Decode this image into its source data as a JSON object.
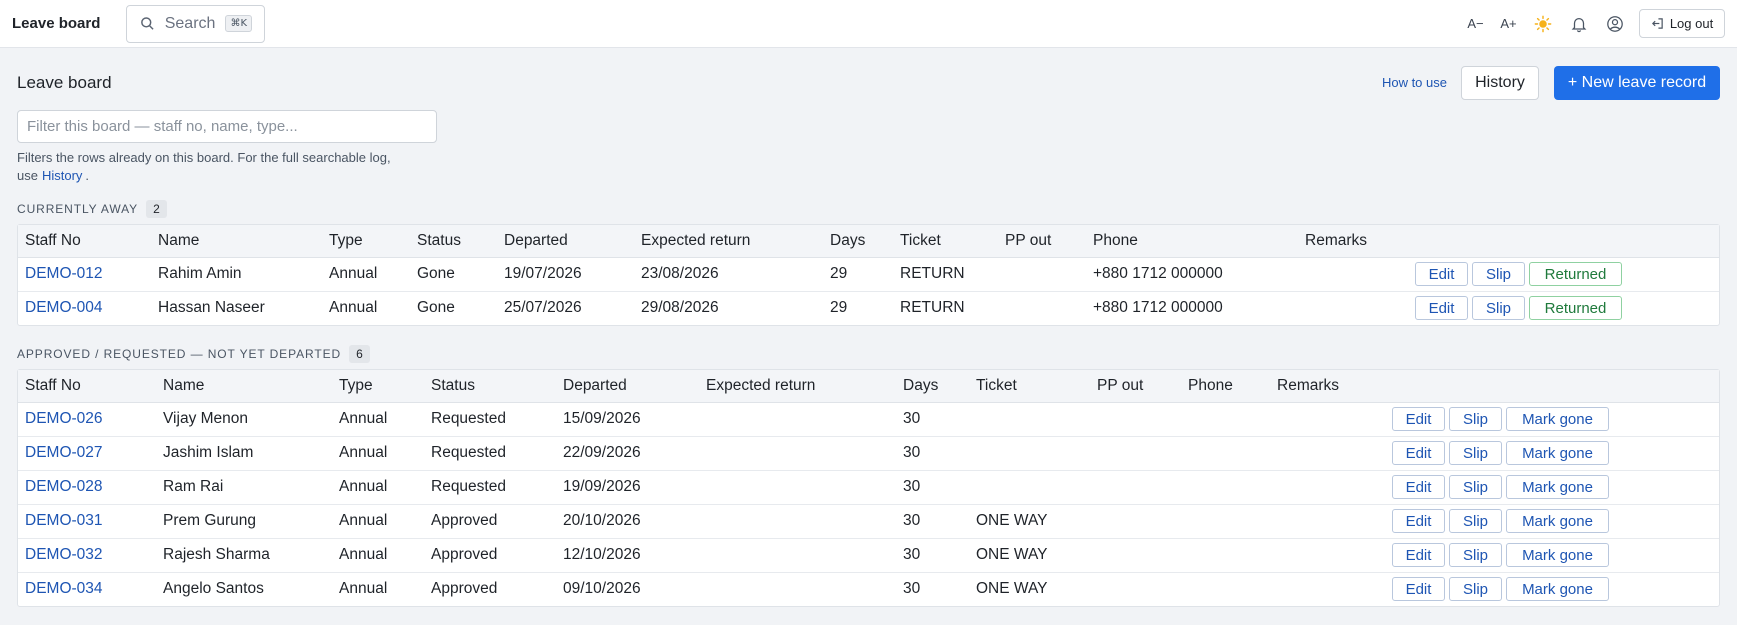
{
  "topbar": {
    "brand": "Leave board",
    "search_label": "Search",
    "search_shortcut": "⌘K",
    "font_decrease": "A−",
    "font_increase": "A+",
    "theme_icon": "sun-icon",
    "bell_icon": "bell-icon",
    "user_icon": "user-circle-icon",
    "logout_label": "Log out"
  },
  "header": {
    "title": "Leave board",
    "how_to_use": "How to use",
    "history_button": "History",
    "new_button": "+ New leave record"
  },
  "filter": {
    "placeholder": "Filter this board — staff no, name, type...",
    "help_prefix": "Filters the rows already on this board. For the full searchable log, use",
    "help_link": "History",
    "help_suffix": "."
  },
  "away": {
    "label": "CURRENTLY AWAY",
    "count": "2",
    "columns": [
      "Staff No",
      "Name",
      "Type",
      "Status",
      "Departed",
      "Expected return",
      "Days",
      "Ticket",
      "PP out",
      "Phone",
      "Remarks"
    ],
    "rows": [
      {
        "staff_no": "DEMO-012",
        "name": "Rahim Amin",
        "type": "Annual",
        "status": "Gone",
        "departed": "19/07/2026",
        "expected_return": "23/08/2026",
        "days": "29",
        "ticket": "RETURN",
        "pp_out": "",
        "phone": "+880 1712 000000",
        "remarks": ""
      },
      {
        "staff_no": "DEMO-004",
        "name": "Hassan Naseer",
        "type": "Annual",
        "status": "Gone",
        "departed": "25/07/2026",
        "expected_return": "29/08/2026",
        "days": "29",
        "ticket": "RETURN",
        "pp_out": "",
        "phone": "+880 1712 000000",
        "remarks": ""
      }
    ],
    "actions": {
      "edit": "Edit",
      "slip": "Slip",
      "returned": "Returned"
    }
  },
  "pending": {
    "label": "APPROVED / REQUESTED — NOT YET DEPARTED",
    "count": "6",
    "columns": [
      "Staff No",
      "Name",
      "Type",
      "Status",
      "Departed",
      "Expected return",
      "Days",
      "Ticket",
      "PP out",
      "Phone",
      "Remarks"
    ],
    "rows": [
      {
        "staff_no": "DEMO-026",
        "name": "Vijay Menon",
        "type": "Annual",
        "status": "Requested",
        "departed": "15/09/2026",
        "expected_return": "",
        "days": "30",
        "ticket": "",
        "pp_out": "",
        "phone": "",
        "remarks": ""
      },
      {
        "staff_no": "DEMO-027",
        "name": "Jashim Islam",
        "type": "Annual",
        "status": "Requested",
        "departed": "22/09/2026",
        "expected_return": "",
        "days": "30",
        "ticket": "",
        "pp_out": "",
        "phone": "",
        "remarks": ""
      },
      {
        "staff_no": "DEMO-028",
        "name": "Ram Rai",
        "type": "Annual",
        "status": "Requested",
        "departed": "19/09/2026",
        "expected_return": "",
        "days": "30",
        "ticket": "",
        "pp_out": "",
        "phone": "",
        "remarks": ""
      },
      {
        "staff_no": "DEMO-031",
        "name": "Prem Gurung",
        "type": "Annual",
        "status": "Approved",
        "departed": "20/10/2026",
        "expected_return": "",
        "days": "30",
        "ticket": "ONE WAY",
        "pp_out": "",
        "phone": "",
        "remarks": ""
      },
      {
        "staff_no": "DEMO-032",
        "name": "Rajesh Sharma",
        "type": "Annual",
        "status": "Approved",
        "departed": "12/10/2026",
        "expected_return": "",
        "days": "30",
        "ticket": "ONE WAY",
        "pp_out": "",
        "phone": "",
        "remarks": ""
      },
      {
        "staff_no": "DEMO-034",
        "name": "Angelo Santos",
        "type": "Annual",
        "status": "Approved",
        "departed": "09/10/2026",
        "expected_return": "",
        "days": "30",
        "ticket": "ONE WAY",
        "pp_out": "",
        "phone": "",
        "remarks": ""
      }
    ],
    "actions": {
      "edit": "Edit",
      "slip": "Slip",
      "mark_gone": "Mark gone"
    }
  },
  "colors": {
    "primary": "#1f6fe8",
    "link": "#1e55b3",
    "returned_border": "#8fd1a1",
    "returned_text": "#1f7a3c"
  }
}
